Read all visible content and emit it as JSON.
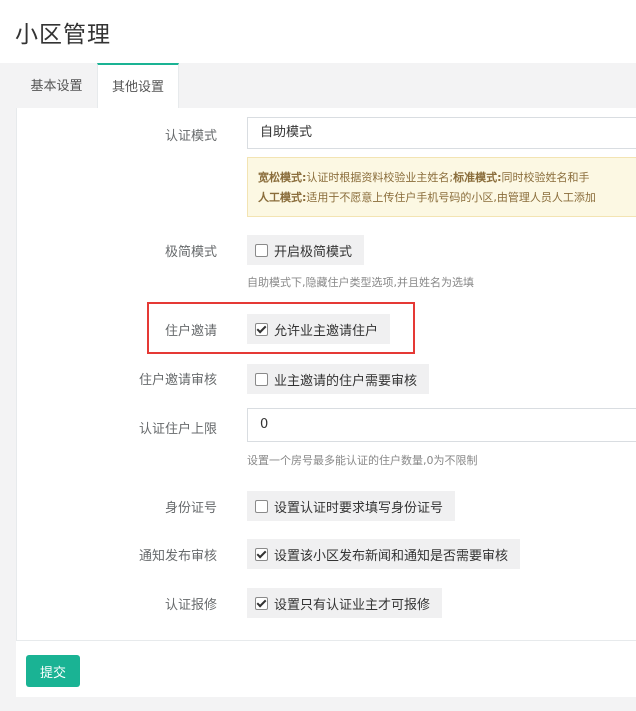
{
  "page": {
    "title": "小区管理"
  },
  "tabs": [
    {
      "label": "基本设置",
      "active": false
    },
    {
      "label": "其他设置",
      "active": true
    }
  ],
  "form": {
    "auth_mode": {
      "label": "认证模式",
      "value": "自助模式",
      "notice": {
        "loose_title": "宽松模式:",
        "loose_text": "认证时根据资料校验业主姓名;",
        "standard_title": "标准模式:",
        "standard_text": "同时校验姓名和手",
        "manual_title": "人工模式:",
        "manual_text": "适用于不愿意上传住户手机号码的小区,由管理人员人工添加"
      }
    },
    "simple_mode": {
      "label": "极简模式",
      "checkbox_label": "开启极简模式",
      "checked": false,
      "help": "自助模式下,隐藏住户类型选项,并且姓名为选填"
    },
    "resident_invite": {
      "label": "住户邀请",
      "checkbox_label": "允许业主邀请住户",
      "checked": true
    },
    "invite_review": {
      "label": "住户邀请审核",
      "checkbox_label": "业主邀请的住户需要审核",
      "checked": false
    },
    "resident_limit": {
      "label": "认证住户上限",
      "value": "0",
      "help": "设置一个房号最多能认证的住户数量,0为不限制"
    },
    "id_card": {
      "label": "身份证号",
      "checkbox_label": "设置认证时要求填写身份证号",
      "checked": false
    },
    "publish_review": {
      "label": "通知发布审核",
      "checkbox_label": "设置该小区发布新闻和通知是否需要审核",
      "checked": true
    },
    "repair_auth": {
      "label": "认证报修",
      "checkbox_label": "设置只有认证业主才可报修",
      "checked": true
    }
  },
  "footer": {
    "submit_label": "提交"
  },
  "colors": {
    "accent": "#1ab394",
    "highlight": "#e53935",
    "notice_bg": "#fcf8e3"
  }
}
